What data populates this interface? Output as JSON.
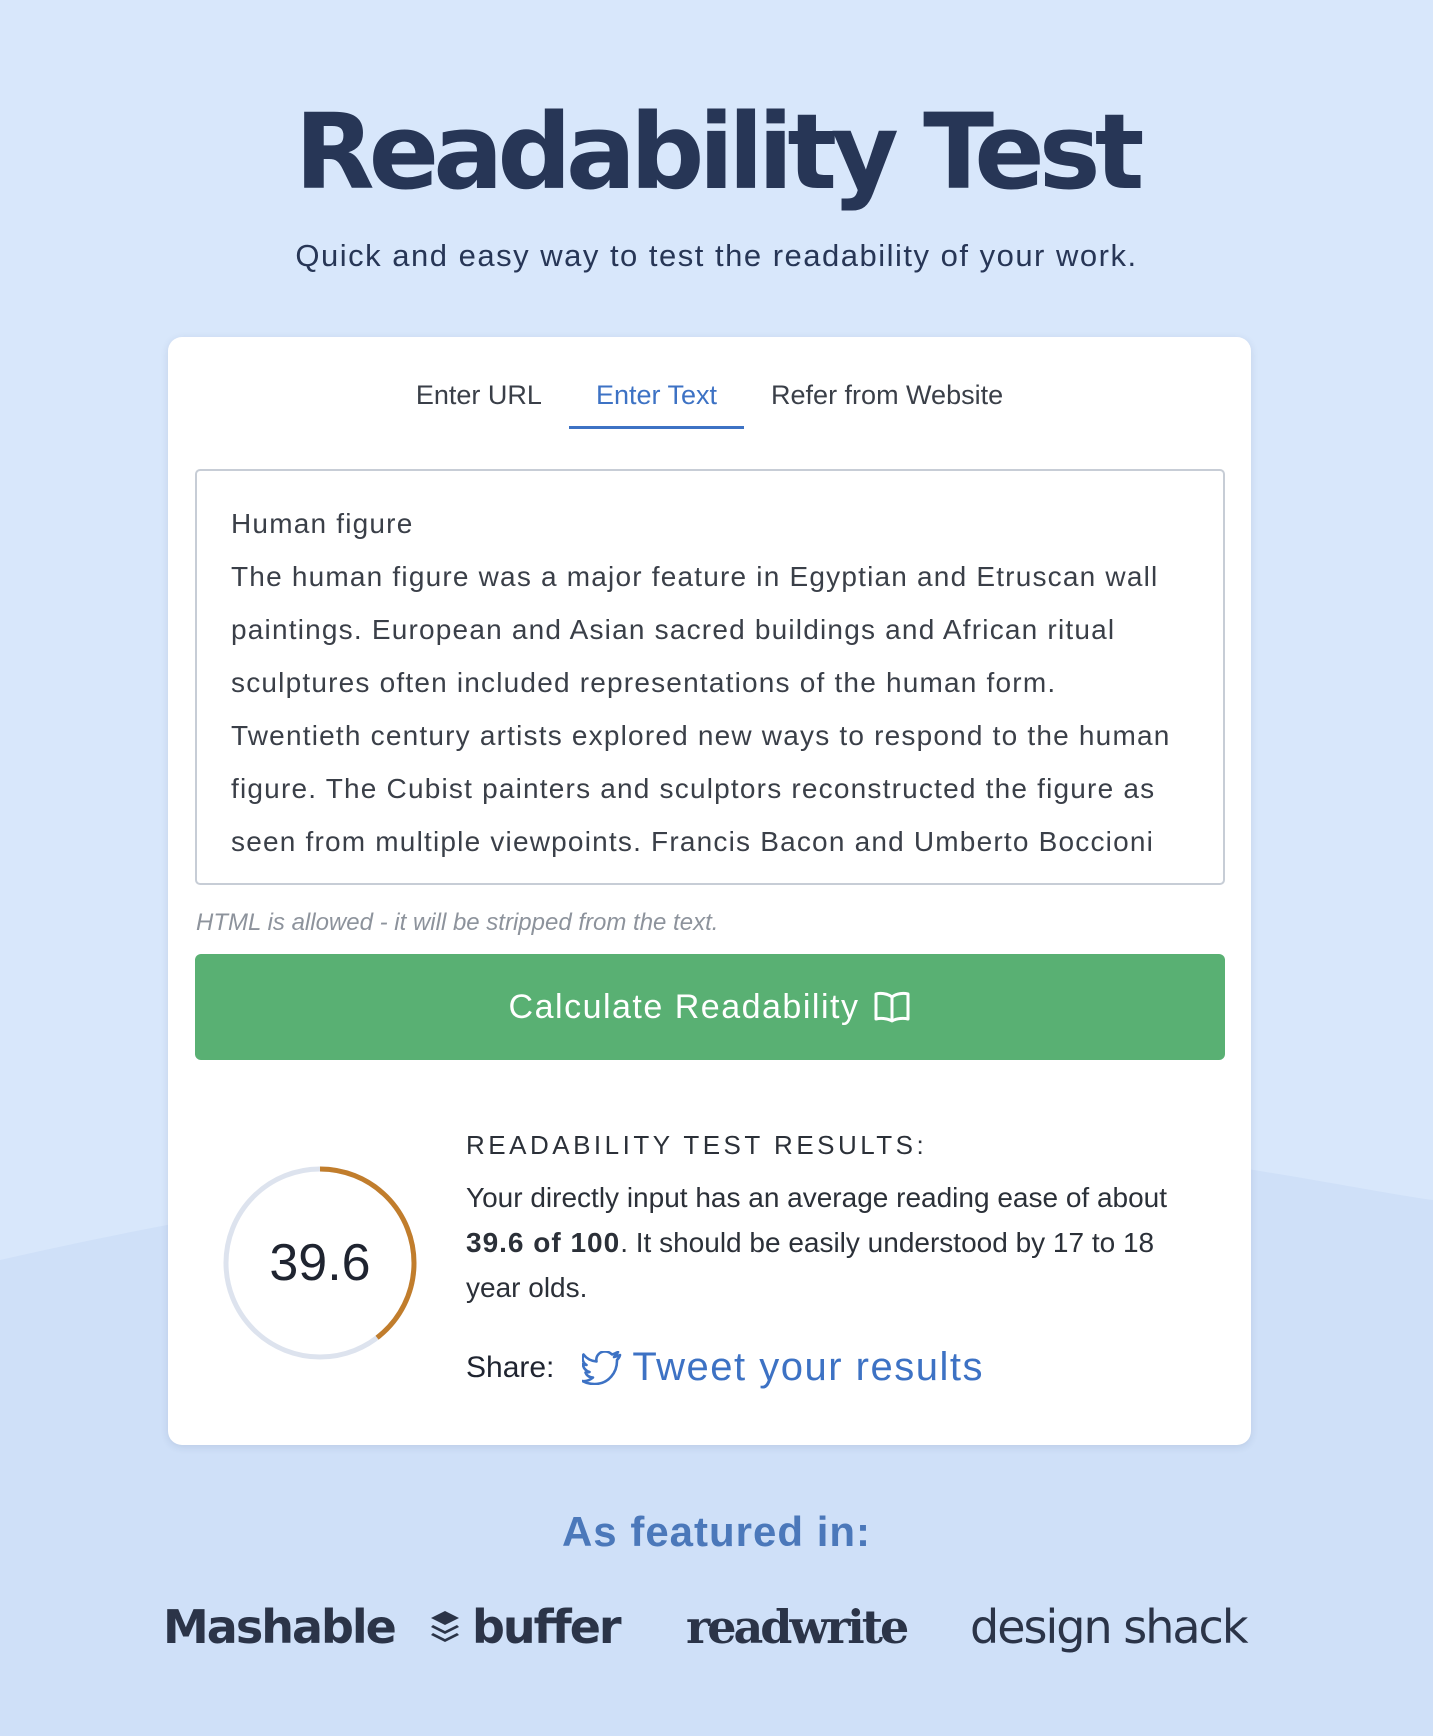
{
  "hero": {
    "title": "Readability Test",
    "subtitle": "Quick and easy way to test the readability of your work."
  },
  "tabs": [
    {
      "label": "Enter URL",
      "active": false
    },
    {
      "label": "Enter Text",
      "active": true
    },
    {
      "label": "Refer from Website",
      "active": false
    }
  ],
  "input": {
    "text": "Human figure\nThe human figure was a major feature in Egyptian and Etruscan wall paintings. European and Asian sacred buildings and African ritual sculptures often included representations of the human form. Twentieth century artists explored new ways to respond to the human figure. The Cubist painters and sculptors reconstructed the figure as seen from multiple viewpoints. Francis Bacon and Umberto Boccioni were inspired to create",
    "hint": "HTML is allowed - it will be stripped from the text."
  },
  "calculate_button": {
    "label": "Calculate Readability",
    "icon": "open-book-icon"
  },
  "results": {
    "score": "39.6",
    "score_fraction": 0.396,
    "heading": "READABILITY TEST RESULTS:",
    "text_before": "Your directly input has an average reading ease of about ",
    "score_text": "39.6 of 100",
    "text_after": ". It should be easily understood by 17 to 18 year olds.",
    "share_label": "Share:",
    "tweet_label": "Tweet your results",
    "tweet_icon": "twitter-bird-icon"
  },
  "featured": {
    "heading": "As featured in:",
    "logos": [
      "Mashable",
      "buffer",
      "readwrite",
      "design shack"
    ]
  },
  "colors": {
    "background": "#d8e7fb",
    "title": "#273656",
    "accent_blue": "#3d72c4",
    "button_green": "#59b073",
    "gauge_progress": "#c17d2c",
    "gauge_track": "#dde3ee"
  }
}
